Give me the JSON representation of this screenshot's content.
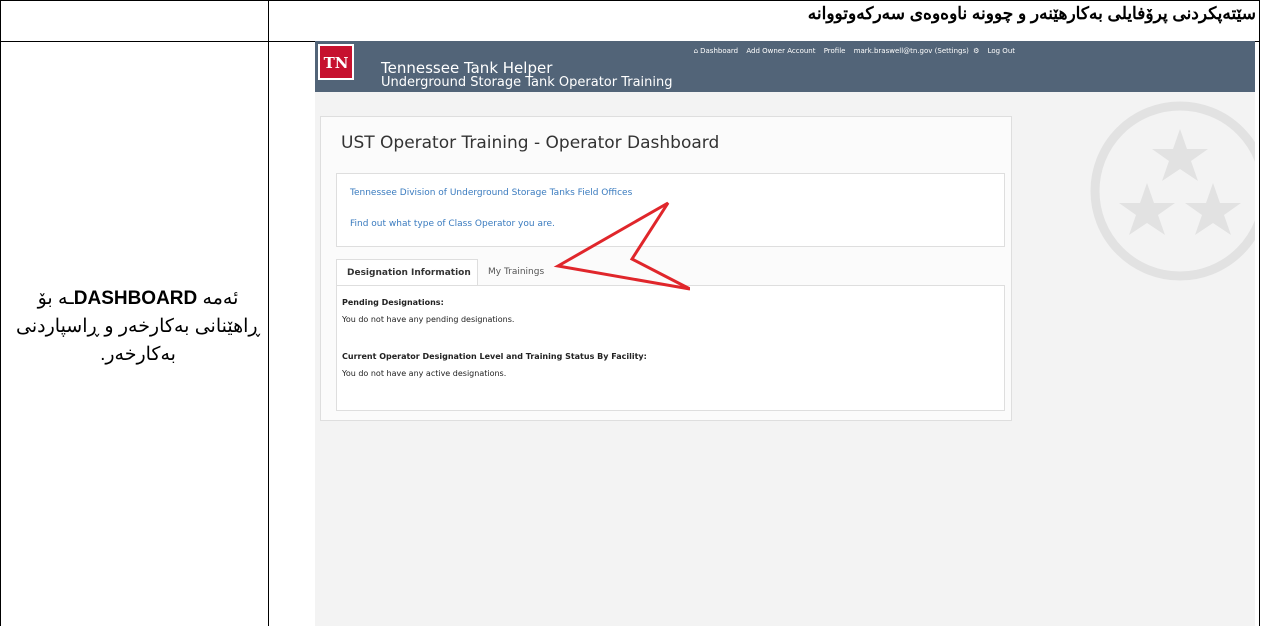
{
  "document": {
    "heading": "سێتەپکردنی پرۆفایلی بەکارهێنەر و چوونە ناوەوەی سەرکەوتووانە",
    "caption_prefix": "ئەمە",
    "caption_keyword": "DASHBOARD",
    "caption_rest": "ـە بۆ ڕاهێنانی بەکارخەر و ڕاسپاردنی بەکارخەر."
  },
  "app": {
    "logo_text": "TN",
    "brand_title": "Tennessee Tank Helper",
    "brand_subtitle": "Underground Storage Tank Operator Training",
    "nav": {
      "dashboard": "Dashboard",
      "add_owner": "Add Owner Account",
      "profile": "Profile",
      "user_settings": "mark.braswell@tn.gov (Settings)",
      "logout": "Log Out"
    },
    "page_title": "UST Operator Training - Operator Dashboard",
    "links": {
      "field_offices": "Tennessee Division of Underground Storage Tanks Field Offices",
      "class_operator": "Find out what type of Class Operator you are."
    },
    "tabs": {
      "designation": "Designation Information",
      "trainings": "My Trainings"
    },
    "panel": {
      "pending_heading": "Pending Designations:",
      "pending_text": "You do not have any pending designations.",
      "current_heading": "Current Operator Designation Level and Training Status By Facility:",
      "current_text": "You do not have any active designations."
    },
    "colors": {
      "navbar": "#526478",
      "logo": "#c6112e",
      "link": "#3a7bbf",
      "arrow": "#e0262b"
    }
  }
}
